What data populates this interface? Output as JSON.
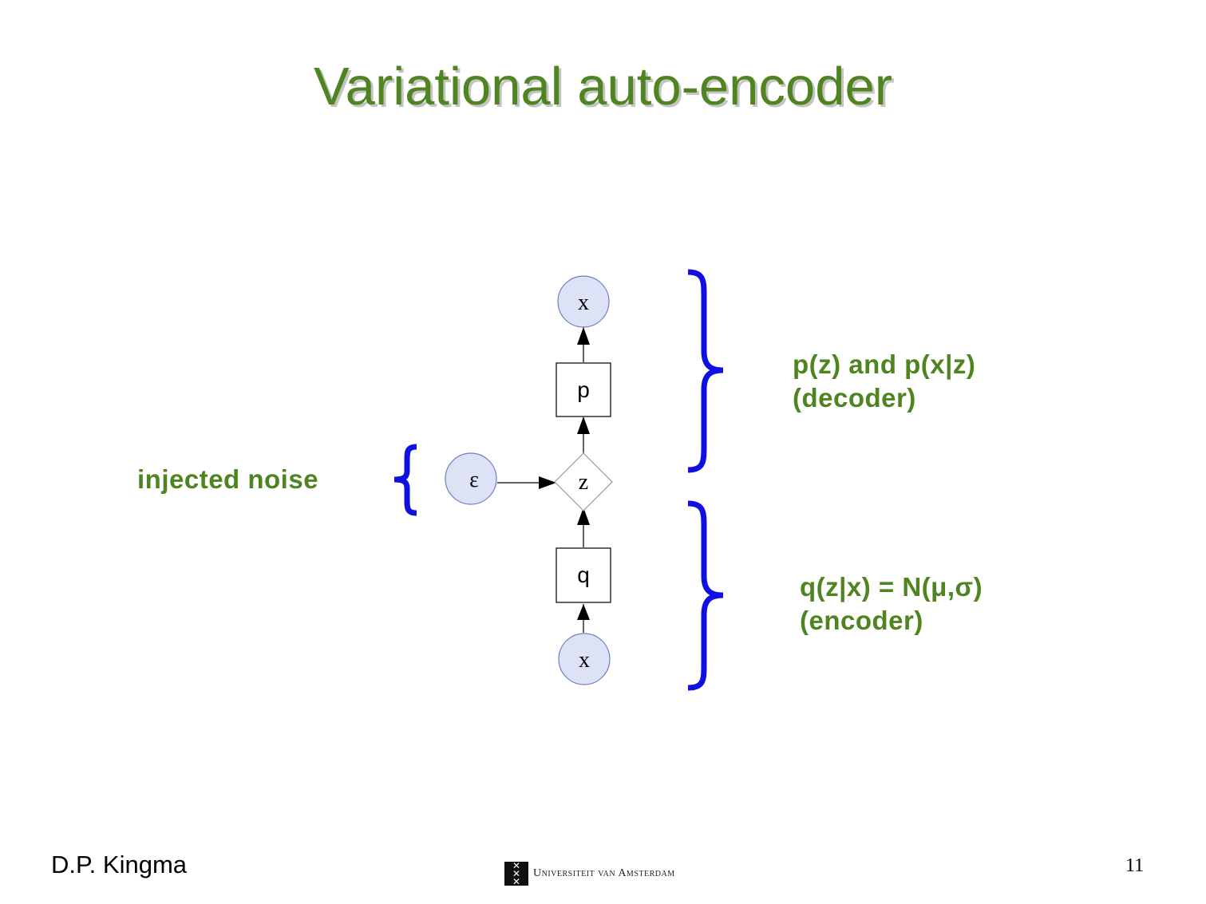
{
  "slide": {
    "title": "Variational auto-encoder",
    "author": "D.P. Kingma",
    "page_number": "11",
    "university": "Universiteit van Amsterdam"
  },
  "diagram": {
    "nodes": {
      "x_top": "x",
      "p_box": "p",
      "z": "z",
      "epsilon": "ε",
      "q_box": "q",
      "x_bottom": "x"
    },
    "annotations": {
      "noise": "injected noise",
      "decoder_line1": "p(z) and p(x|z)",
      "decoder_line2": "(decoder)",
      "encoder_line1": "q(z|x) = N(μ,σ)",
      "encoder_line2": "(encoder)"
    }
  },
  "colors": {
    "title": "#4f8421",
    "title_shadow": "#c4c4c4",
    "annotation_text": "#4f8421",
    "brace": "#1010e0",
    "circle_fill": "#dde2f7",
    "circle_stroke": "#6f7fc0"
  }
}
